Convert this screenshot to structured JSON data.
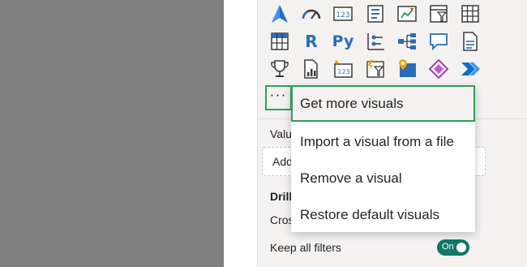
{
  "visuals_pane": {
    "icons": [
      "azure-map-icon",
      "gauge-icon",
      "card-icon",
      "multi-row-card-icon",
      "kpi-icon",
      "slicer-icon",
      "table-icon",
      "matrix-icon",
      "r-visual-icon",
      "python-visual-icon",
      "key-influencers-icon",
      "decomposition-tree-icon",
      "qa-icon",
      "smart-narrative-icon",
      "metrics-icon",
      "paginated-report-icon",
      "power-apps-icon",
      "power-automate-icon"
    ],
    "r_label": "R",
    "py_label": "Py",
    "more_button_label": "···",
    "values_label": "Valu",
    "add_data_label": "Add",
    "drill_label": "Drill",
    "cross_report_label": "Cros",
    "keep_all_filters_label": "Keep all filters",
    "toggle_label": "On"
  },
  "context_menu": {
    "items": [
      "Get more visuals",
      "Import a visual from a file",
      "Remove a visual",
      "Restore default visuals"
    ]
  },
  "colors": {
    "canvas_gray": "#808080",
    "highlight_green": "#2e9e58",
    "toggle_teal": "#117865",
    "icon_blue": "#2b6cb8"
  }
}
